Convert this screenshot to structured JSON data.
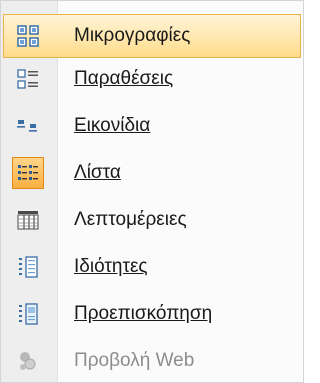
{
  "menu": {
    "items": [
      {
        "label": "Μικρογραφίες",
        "icon": "thumbnails-icon",
        "state": "hover"
      },
      {
        "label": "Παραθέσεις",
        "icon": "tiles-icon",
        "state": "normal",
        "mnemonic_index": 0
      },
      {
        "label": "Εικονίδια",
        "icon": "icons-icon",
        "state": "normal",
        "mnemonic_index": 0
      },
      {
        "label": "Λίστα",
        "icon": "list-icon",
        "state": "checked",
        "mnemonic_index": 0
      },
      {
        "label": "Λεπτομέρειες",
        "icon": "details-icon",
        "state": "normal",
        "mnemonic_index": 5
      },
      {
        "label": "Ιδιότητες",
        "icon": "properties-icon",
        "state": "normal",
        "mnemonic_index": 0
      },
      {
        "label": "Προεπισκόπηση",
        "icon": "preview-icon",
        "state": "normal",
        "mnemonic_index": 0
      },
      {
        "label": "Προβολή Web",
        "icon": "web-view-icon",
        "state": "disabled",
        "mnemonic_index": 8
      }
    ]
  },
  "colors": {
    "hover_bg": "#ffdc8a",
    "checked_bg": "#fbb040",
    "icon_blue": "#2b6cb0",
    "disabled_text": "#8d8d8d"
  }
}
